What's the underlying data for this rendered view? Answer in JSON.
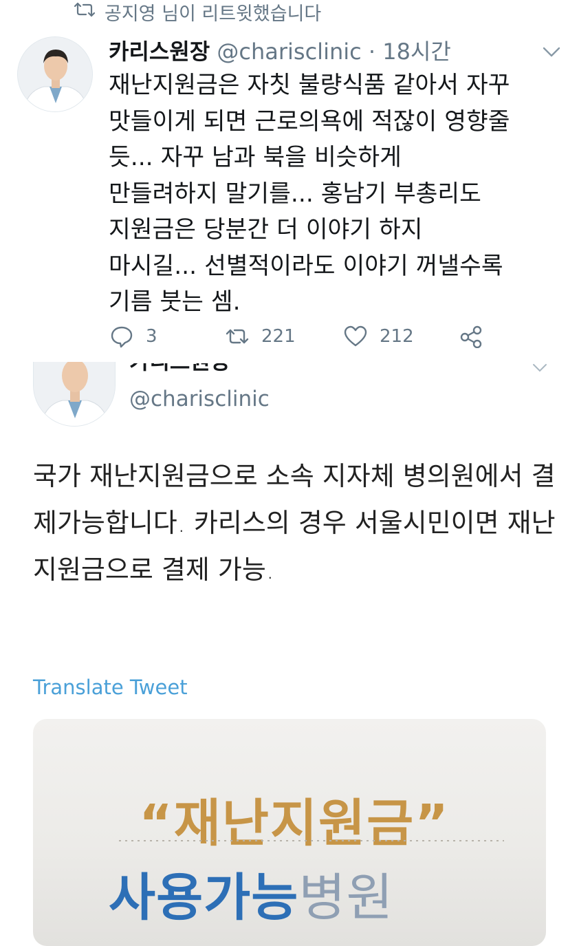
{
  "retweet": {
    "label": "공지영 님이 리트윗했습니다",
    "icon": "retweet-icon"
  },
  "tweet1": {
    "display_name": "카리스원장",
    "handle": "@charisclinic",
    "time": "· 18시간",
    "text": "재난지원금은 자칫 불량식품 같아서 자꾸\n맛들이게 되면 근로의욕에 적잖이 영향줄\n듯... 자꾸 남과 북을 비슷하게\n만들려하지 말기를... 홍남기 부총리도\n지원금은 당분간 더 이야기 하지\n마시길... 선별적이라도 이야기 꺼낼수록\n기름 붓는 셈.",
    "actions": {
      "replies": "3",
      "retweets": "221",
      "likes": "212"
    }
  },
  "tweet2": {
    "display_name_cut": "카리스원장",
    "handle": "@charisclinic",
    "text": "국가 재난지원금으로 소속 지자체 병의원에서 결제가능합니다. 카리스의 경우 서울시민이면 재난지원금으로 결제 가능.",
    "translate_label": "Translate Tweet",
    "media": {
      "title": "“재난지원금”",
      "subtitle_bold": "사용가능",
      "subtitle_light": "병원"
    }
  },
  "colors": {
    "secondary_text": "#657786",
    "link": "#4aa0d8",
    "media_gold": "#c79547",
    "media_blue": "#2d6fb6"
  }
}
